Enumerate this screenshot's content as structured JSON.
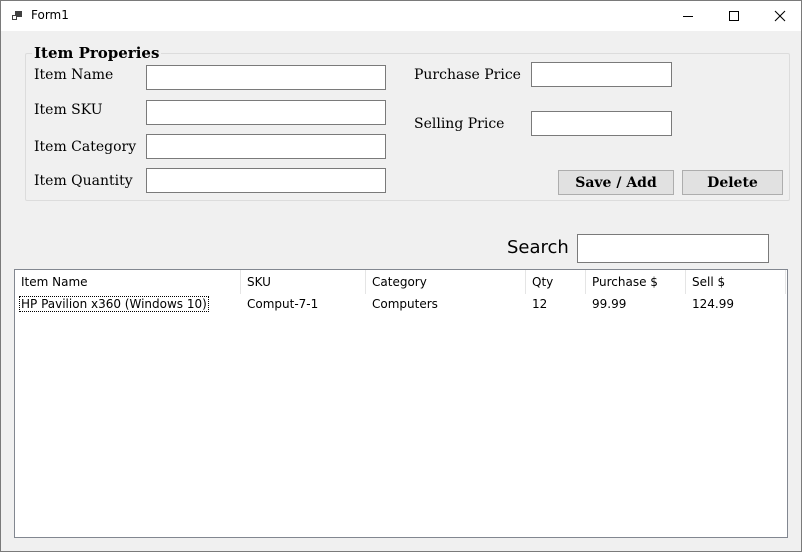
{
  "window": {
    "title": "Form1"
  },
  "group": {
    "title": "Item Properies"
  },
  "fields": {
    "item_name_label": "Item Name",
    "item_name_value": "",
    "item_sku_label": "Item SKU",
    "item_sku_value": "",
    "item_category_label": "Item Category",
    "item_category_value": "",
    "item_quantity_label": "Item Quantity",
    "item_quantity_value": "",
    "purchase_price_label": "Purchase Price",
    "purchase_price_value": "",
    "selling_price_label": "Selling Price",
    "selling_price_value": ""
  },
  "buttons": {
    "save_label": "Save / Add",
    "delete_label": "Delete"
  },
  "search": {
    "label": "Search",
    "value": ""
  },
  "list": {
    "columns": [
      "Item Name",
      "SKU",
      "Category",
      "Qty",
      "Purchase $",
      "Sell $"
    ],
    "rows": [
      [
        "HP Pavilion x360 (Windows 10)",
        "Comput-7-1",
        "Computers",
        "12",
        "99.99",
        "124.99"
      ]
    ]
  }
}
